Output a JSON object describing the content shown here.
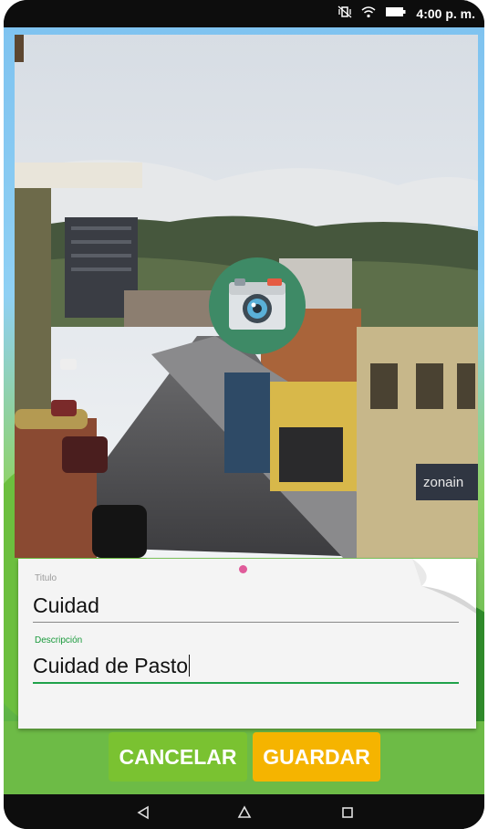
{
  "status_bar": {
    "time": "4:00 p. m.",
    "icons": [
      "vibrate-icon",
      "wifi-icon",
      "battery-icon"
    ]
  },
  "photo": {
    "description_icon": "camera-icon",
    "sign_text": "zonain"
  },
  "form": {
    "title_label": "Titulo",
    "title_value": "Cuidad",
    "description_label": "Descripción",
    "description_value": "Cuidad de Pasto"
  },
  "buttons": {
    "cancel_label": "CANCELAR",
    "save_label": "GUARDAR"
  },
  "navigation": {
    "back_icon": "back-icon",
    "home_icon": "home-icon",
    "recents_icon": "recents-icon"
  },
  "colors": {
    "cancel": "#7ac231",
    "save": "#f5b400",
    "active_field": "#1fa24a",
    "camera_button": "#3e8a66"
  }
}
